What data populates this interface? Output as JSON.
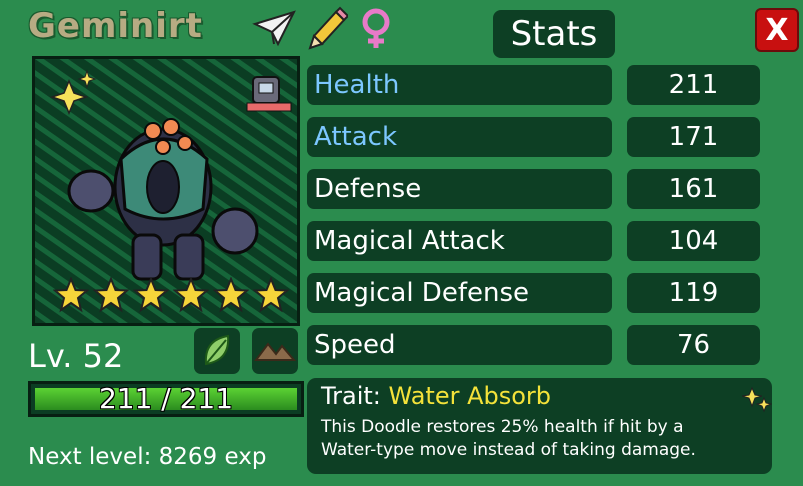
{
  "doodle": {
    "name": "Geminirt",
    "level_label": "Lv. 52",
    "stars": 6,
    "hp_text": "211 / 211",
    "hp_fraction": 1.0,
    "next_level_text": "Next level: 8269 exp"
  },
  "header": {
    "stats_title": "Stats",
    "close_label": "X",
    "icons": [
      "paper-plane-icon",
      "pencil-icon",
      "female-icon"
    ]
  },
  "stats": [
    {
      "label": "Health",
      "value": "211",
      "highlight": true
    },
    {
      "label": "Attack",
      "value": "171",
      "highlight": true
    },
    {
      "label": "Defense",
      "value": "161",
      "highlight": false
    },
    {
      "label": "Magical Attack",
      "value": "104",
      "highlight": false
    },
    {
      "label": "Magical Defense",
      "value": "119",
      "highlight": false
    },
    {
      "label": "Speed",
      "value": "76",
      "highlight": false
    }
  ],
  "trait": {
    "prefix": "Trait:",
    "name": "Water Absorb",
    "description": "This Doodle restores 25% health if hit by a Water-type move instead of taking damage."
  },
  "types": [
    "leaf-icon",
    "mountain-icon"
  ],
  "colors": {
    "background": "#2b8c4e",
    "panel": "#0d3f24",
    "stat_highlight": "#7cc7ff",
    "trait_name": "#f4e23a",
    "close": "#c81010"
  }
}
